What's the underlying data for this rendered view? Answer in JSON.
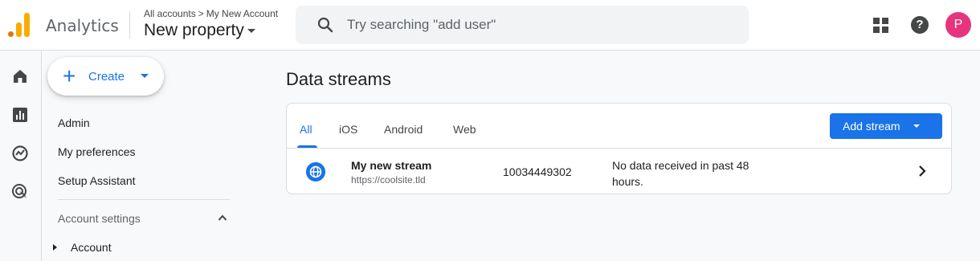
{
  "header": {
    "app_name": "Analytics",
    "breadcrumb": [
      "All accounts",
      "My New Account"
    ],
    "breadcrumb_separator": ">",
    "property_name": "New property",
    "search_placeholder": "Try searching \"add user\"",
    "avatar_initial": "P",
    "help_label": "?"
  },
  "rail": {
    "icons": [
      "home-icon",
      "reports-icon",
      "explore-icon",
      "advertising-icon"
    ]
  },
  "nav": {
    "create_label": "Create",
    "items": [
      "Admin",
      "My preferences",
      "Setup Assistant"
    ],
    "section_label": "Account settings",
    "sub_item": "Account"
  },
  "main": {
    "title": "Data streams",
    "tabs": [
      "All",
      "iOS",
      "Android",
      "Web"
    ],
    "active_tab": "All",
    "add_stream_label": "Add stream",
    "streams": [
      {
        "name": "My new stream",
        "url": "https://coolsite.tld",
        "id": "10034449302",
        "status_line1": "No data received in past 48",
        "status_line2": "hours.",
        "icon": "globe-icon"
      }
    ]
  },
  "colors": {
    "accent": "#1a73e8",
    "avatar": "#e8347d",
    "logo_orange": "#e37400",
    "logo_yellow": "#f9ab00"
  }
}
